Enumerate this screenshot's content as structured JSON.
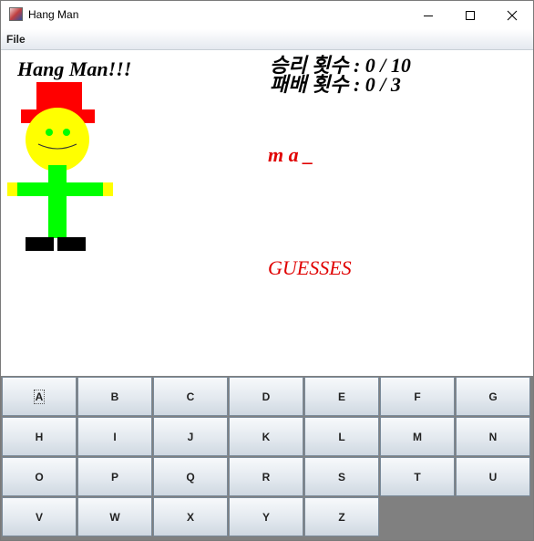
{
  "window": {
    "title": "Hang Man"
  },
  "menu": {
    "file": "File"
  },
  "game": {
    "title": "Hang Man!!!",
    "wins_label": "승리 횟수 : 0 / 10",
    "losses_label": "패배 횟수 : 0 / 3",
    "word": "m a _",
    "guesses_label": "GUESSES"
  },
  "keyboard": {
    "keys": [
      "A",
      "B",
      "C",
      "D",
      "E",
      "F",
      "G",
      "H",
      "I",
      "J",
      "K",
      "L",
      "M",
      "N",
      "O",
      "P",
      "Q",
      "R",
      "S",
      "T",
      "U",
      "V",
      "W",
      "X",
      "Y",
      "Z"
    ],
    "focused_key": "A"
  },
  "colors": {
    "hat": "#ff0000",
    "face": "#ffff00",
    "eyes": "#00ff00",
    "body": "#00ff00",
    "hands": "#ffff00",
    "shoes": "#000000",
    "text_red": "#e00000"
  }
}
